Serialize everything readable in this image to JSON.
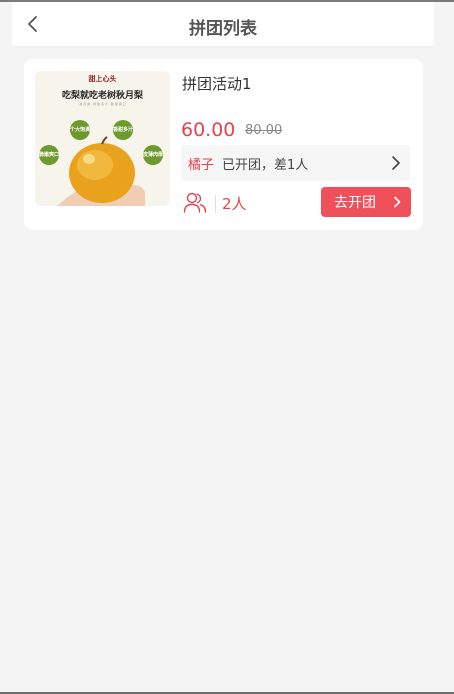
{
  "header": {
    "title": "拼团列表",
    "back_icon": "chevron-left-icon"
  },
  "activity": {
    "title": "拼团活动1",
    "price": "60.00",
    "original_price": "80.00",
    "product_image": {
      "brand": "甜上心头",
      "headline": "吃梨就吃老树秋月梨",
      "subline": "秋 月 梨 · 香 甜 多 汁 · 脆 嫩 爽 口",
      "badges": [
        "个大饱满",
        "香甜多汁",
        "脆嫩爽口",
        "皮薄肉厚"
      ]
    },
    "group": {
      "leader": "橘子",
      "status": "已开团，差1人"
    },
    "people_count": "2人",
    "open_button": "去开团"
  },
  "colors": {
    "accent": "#e1454e",
    "button": "#ef5059",
    "background": "#f4f4f4"
  }
}
